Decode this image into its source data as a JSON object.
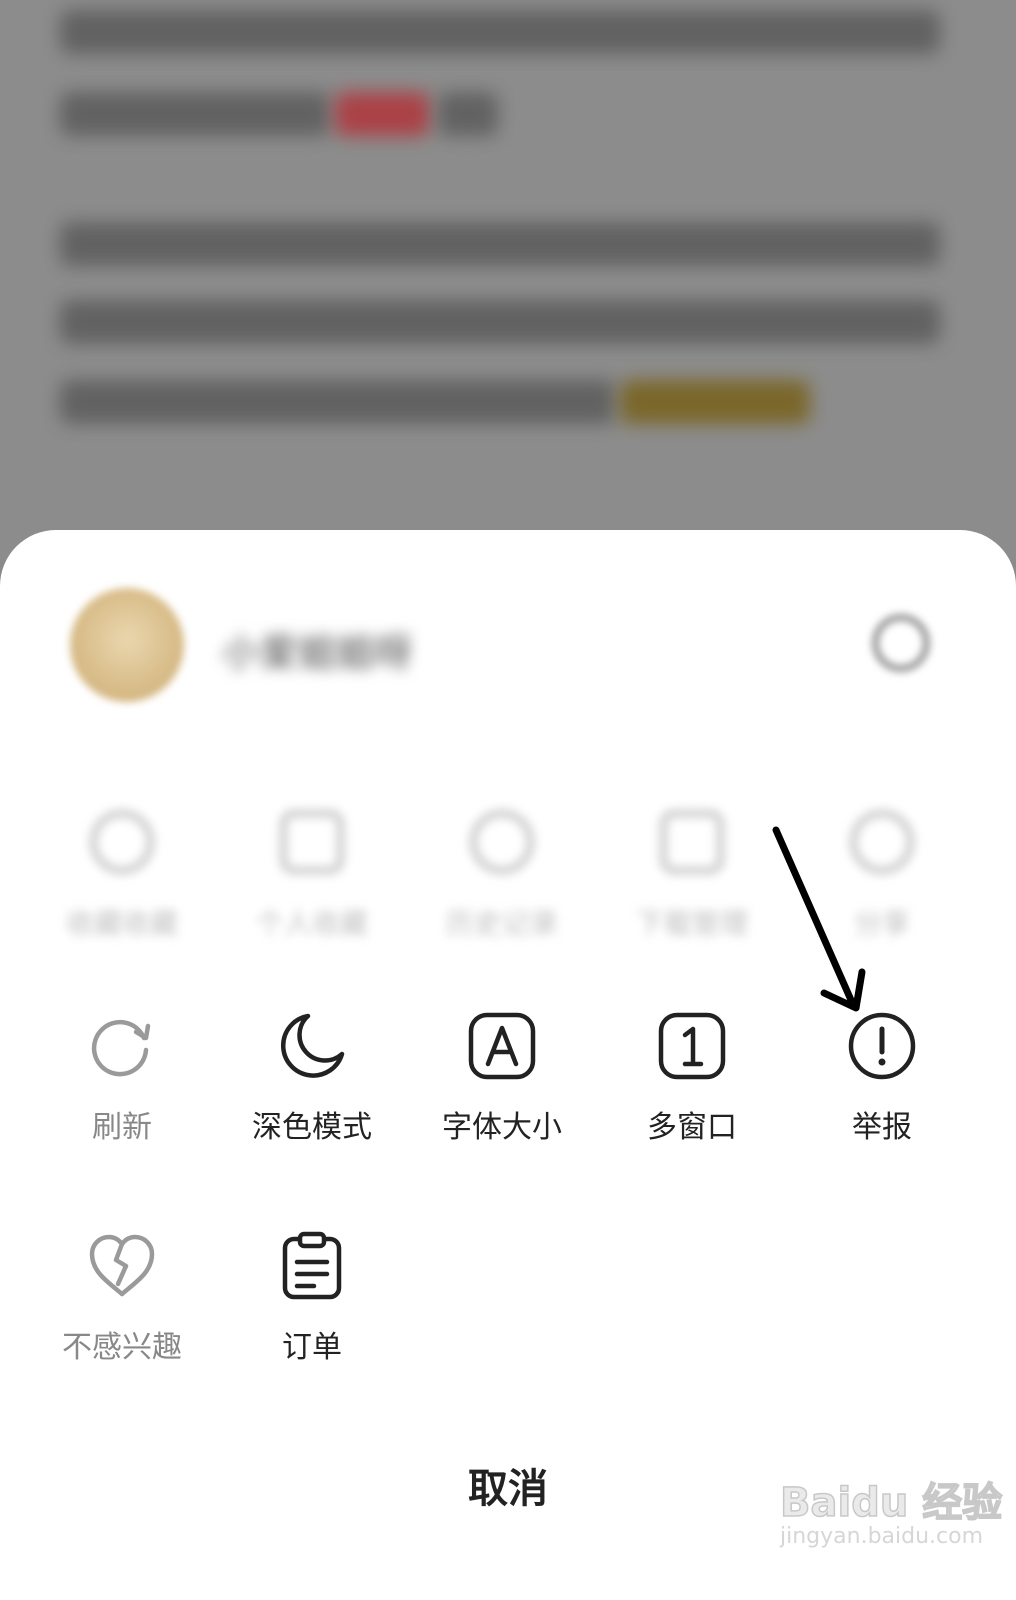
{
  "article": {
    "background_text_note": ""
  },
  "account": {
    "name": "小爱姐姐呀"
  },
  "blurred_actions": [
    {
      "label": "收藏收藏",
      "icon": "star-icon"
    },
    {
      "label": "个人收藏",
      "icon": "bookmark-icon"
    },
    {
      "label": "历史记录",
      "icon": "clock-icon"
    },
    {
      "label": "下载管理",
      "icon": "download-icon"
    },
    {
      "label": "分享",
      "icon": "cloud-icon"
    }
  ],
  "actions": [
    {
      "label": "刷新",
      "icon": "refresh-icon",
      "muted": true
    },
    {
      "label": "深色模式",
      "icon": "moon-icon",
      "muted": false
    },
    {
      "label": "字体大小",
      "icon": "font-size-icon",
      "muted": false
    },
    {
      "label": "多窗口",
      "icon": "multi-window-icon",
      "muted": false
    },
    {
      "label": "举报",
      "icon": "report-icon",
      "muted": false
    }
  ],
  "actions_row2": [
    {
      "label": "不感兴趣",
      "icon": "broken-heart-icon",
      "muted": true
    },
    {
      "label": "订单",
      "icon": "order-icon",
      "muted": false
    }
  ],
  "cancel_label": "取消",
  "watermark": {
    "brand": "Baidu 经验",
    "url": "jingyan.baidu.com"
  },
  "colors": {
    "sheet": "#ffffff",
    "text": "#222222",
    "muted": "#888888",
    "backdrop": "#8c8c8c"
  }
}
